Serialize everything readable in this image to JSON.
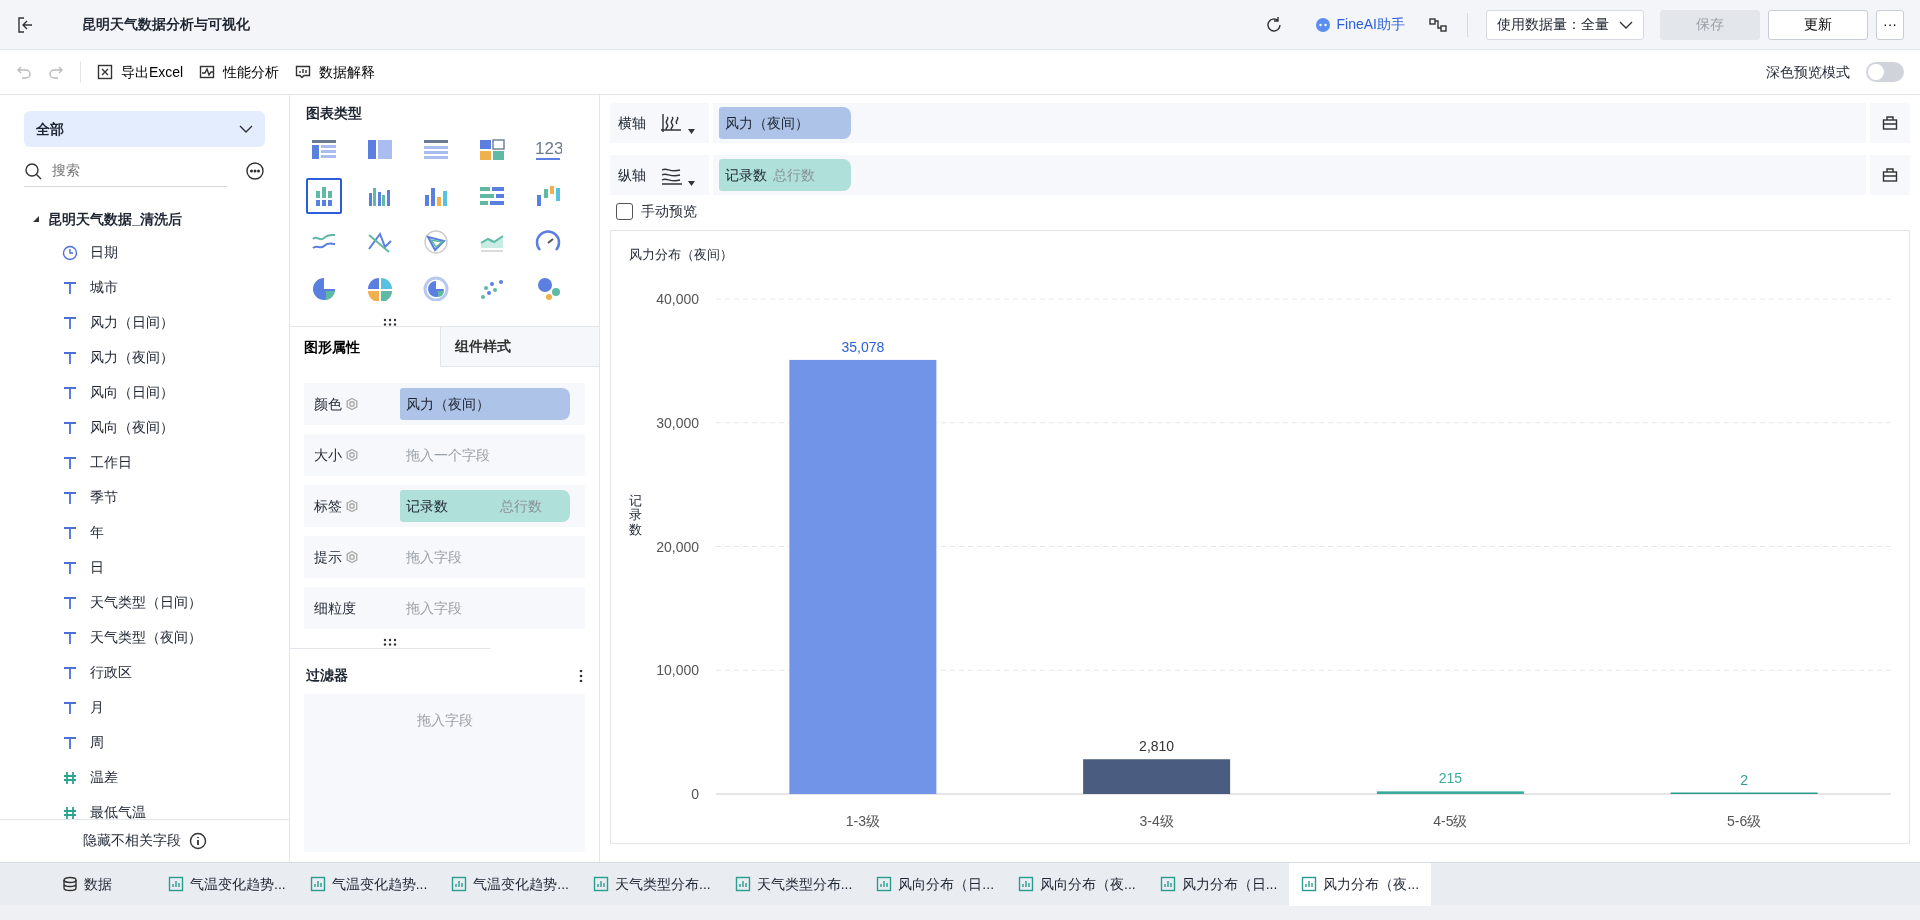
{
  "top_bar": {
    "title": "昆明天气数据分析与可视化",
    "ai_button": "FineAI助手",
    "data_amount": "使用数据量：全量",
    "save_button": {
      "label": "保存",
      "disabled": true
    },
    "update_button": "更新",
    "more_button": "···"
  },
  "toolbar": {
    "items": [
      "导出Excel",
      "性能分析",
      "数据解释"
    ],
    "dark_preview": {
      "label": "深色预览模式",
      "on": false
    }
  },
  "fields_panel": {
    "filter": "全部",
    "search_placeholder": "搜索",
    "dataset": {
      "name": "昆明天气数据_清洗后",
      "expanded": true
    },
    "fields": [
      {
        "name": "日期",
        "kind": "date"
      },
      {
        "name": "城市",
        "kind": "text"
      },
      {
        "name": "风力（日间）",
        "kind": "text"
      },
      {
        "name": "风力（夜间）",
        "kind": "text"
      },
      {
        "name": "风向（日间）",
        "kind": "text"
      },
      {
        "name": "风向（夜间）",
        "kind": "text"
      },
      {
        "name": "工作日",
        "kind": "text"
      },
      {
        "name": "季节",
        "kind": "text"
      },
      {
        "name": "年",
        "kind": "text"
      },
      {
        "name": "日",
        "kind": "text"
      },
      {
        "name": "天气类型（日间）",
        "kind": "text"
      },
      {
        "name": "天气类型（夜间）",
        "kind": "text"
      },
      {
        "name": "行政区",
        "kind": "text"
      },
      {
        "name": "月",
        "kind": "text"
      },
      {
        "name": "周",
        "kind": "text"
      },
      {
        "name": "温差",
        "kind": "number"
      },
      {
        "name": "最低气温",
        "kind": "number"
      }
    ],
    "footer": "隐藏不相关字段"
  },
  "chart_types": {
    "title": "图表类型",
    "items": [
      {
        "selected": false
      },
      {
        "selected": false
      },
      {
        "selected": false
      },
      {
        "selected": false
      },
      {
        "selected": false,
        "label": "123"
      },
      {
        "selected": true
      },
      {
        "selected": false
      },
      {
        "selected": false
      },
      {
        "selected": false
      },
      {
        "selected": false
      },
      {
        "selected": false
      },
      {
        "selected": false
      },
      {
        "selected": false
      },
      {
        "selected": false
      },
      {
        "selected": false
      },
      {
        "selected": false
      },
      {
        "selected": false
      },
      {
        "selected": false
      },
      {
        "selected": false
      },
      {
        "selected": false
      }
    ]
  },
  "property_tabs": [
    {
      "label": "图形属性",
      "selected": true
    },
    {
      "label": "组件样式",
      "selected": false
    }
  ],
  "properties": [
    {
      "label": "颜色",
      "gear": true,
      "kind": "field",
      "value": "风力（夜间）",
      "color": "#adc3e8"
    },
    {
      "label": "大小",
      "gear": true,
      "kind": "empty",
      "placeholder": "拖入一个字段"
    },
    {
      "label": "标签",
      "gear": true,
      "kind": "measure",
      "value": "记录数",
      "note": "总行数",
      "color": "#b0e0da"
    },
    {
      "label": "提示",
      "gear": true,
      "kind": "empty",
      "placeholder": "拖入字段"
    },
    {
      "label": "细粒度",
      "gear": false,
      "kind": "empty",
      "placeholder": "拖入字段"
    }
  ],
  "filter": {
    "title": "过滤器",
    "placeholder": "拖入字段"
  },
  "axes": [
    {
      "label": "横轴",
      "kind": "field",
      "value": "风力（夜间）",
      "color": "#adc3e8"
    },
    {
      "label": "纵轴",
      "kind": "measure",
      "value": "记录数",
      "note": "总行数",
      "color": "#b0e0da"
    }
  ],
  "manual_preview": {
    "label": "手动预览",
    "checked": false
  },
  "chart": {
    "title": "风力分布（夜间）",
    "chart_data": {
      "type": "bar",
      "ylabel": "记录数",
      "categories": [
        "1-3级",
        "3-4级",
        "4-5级",
        "5-6级"
      ],
      "series": [
        {
          "colors": [
            "#7294e8",
            "#4a5d80",
            "#3aaa9c",
            "#2a9d8f"
          ],
          "values": [
            35078,
            2810,
            215,
            2
          ]
        }
      ],
      "ylim": [
        0,
        40000
      ],
      "yticks": [
        {
          "value": 0,
          "label": "0"
        },
        {
          "value": 10000,
          "label": "10,000"
        },
        {
          "value": 20000,
          "label": "20,000"
        },
        {
          "value": 30000,
          "label": "30,000"
        },
        {
          "value": 40000,
          "label": "40,000"
        }
      ],
      "value_labels": [
        "35,078",
        "2,810",
        "215",
        "2"
      ],
      "grid": true
    }
  },
  "sheet_tabs": [
    {
      "label": "数据",
      "kind": "data",
      "selected": false
    },
    {
      "label": "气温变化趋势...",
      "kind": "sheet",
      "selected": false
    },
    {
      "label": "气温变化趋势...",
      "kind": "sheet",
      "selected": false
    },
    {
      "label": "气温变化趋势...",
      "kind": "sheet",
      "selected": false
    },
    {
      "label": "天气类型分布...",
      "kind": "sheet",
      "selected": false
    },
    {
      "label": "天气类型分布...",
      "kind": "sheet",
      "selected": false
    },
    {
      "label": "风向分布（日...",
      "kind": "sheet",
      "selected": false
    },
    {
      "label": "风向分布（夜...",
      "kind": "sheet",
      "selected": false
    },
    {
      "label": "风力分布（日...",
      "kind": "sheet",
      "selected": false
    },
    {
      "label": "风力分布（夜...",
      "kind": "sheet",
      "selected": true
    }
  ]
}
